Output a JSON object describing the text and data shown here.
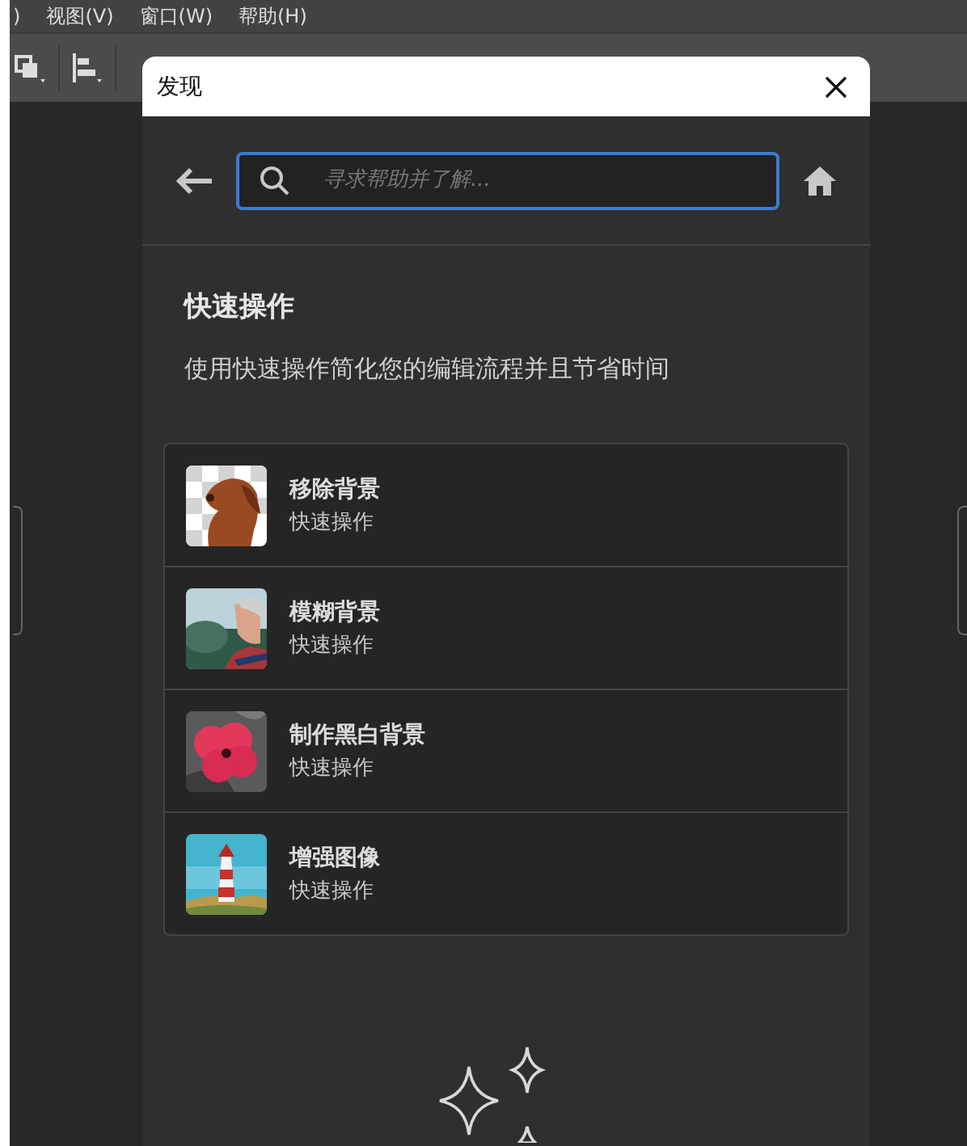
{
  "menu_bar": {
    "items": [
      ")",
      "视图(V)",
      "窗口(W)",
      "帮助(H)"
    ]
  },
  "dialog": {
    "title": "发现",
    "search": {
      "placeholder": "寻求帮助并了解..."
    },
    "section": {
      "heading": "快速操作",
      "description": "使用快速操作简化您的编辑流程并且节省时间"
    },
    "actions": [
      {
        "title": "移除背景",
        "subtitle": "快速操作"
      },
      {
        "title": "模糊背景",
        "subtitle": "快速操作"
      },
      {
        "title": "制作黑白背景",
        "subtitle": "快速操作"
      },
      {
        "title": "增强图像",
        "subtitle": "快速操作"
      }
    ]
  }
}
